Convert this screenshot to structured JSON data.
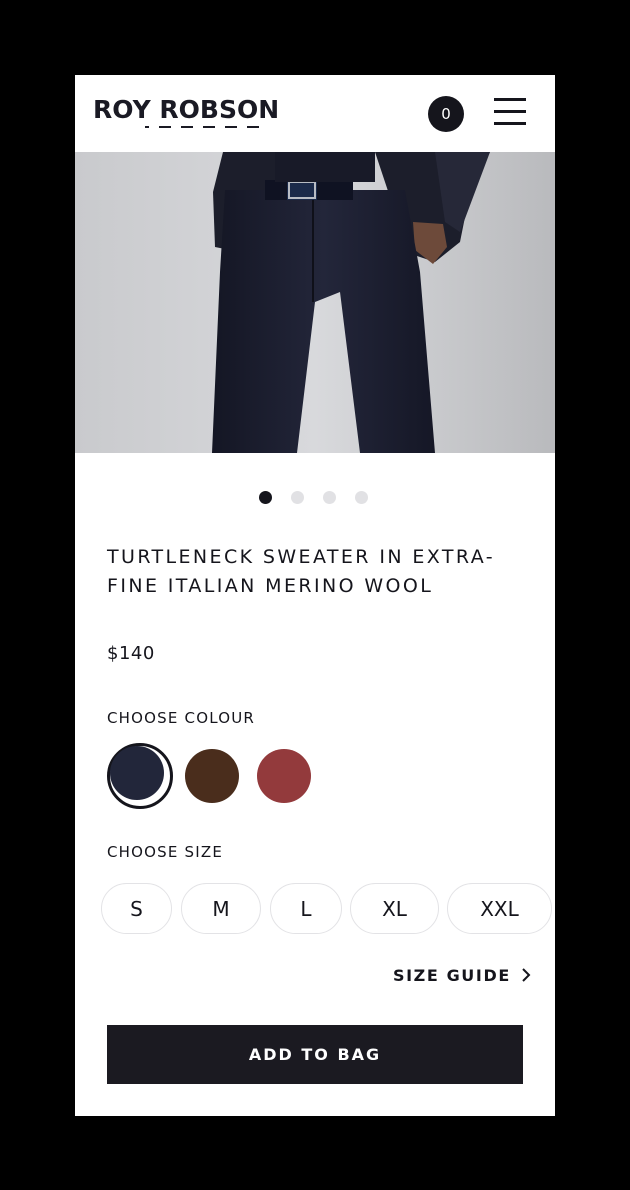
{
  "header": {
    "brand": "ROY ROBSON",
    "cart_count": "0"
  },
  "product": {
    "image_alt": "Model wearing dark navy trousers and jacket with belt",
    "carousel": {
      "total": 4,
      "active_index": 0
    },
    "title": "TURTLENECK SWEATER IN EXTRA-FINE ITALIAN MERINO WOOL",
    "price": "$140"
  },
  "colour": {
    "label": "CHOOSE COLOUR",
    "options": [
      {
        "name": "navy",
        "hex": "#22263a",
        "selected": true
      },
      {
        "name": "brown",
        "hex": "#4a2d1c",
        "selected": false
      },
      {
        "name": "red",
        "hex": "#933a3c",
        "selected": false
      }
    ]
  },
  "size": {
    "label": "CHOOSE SIZE",
    "options": [
      "S",
      "M",
      "L",
      "XL",
      "XXL"
    ],
    "guide_label": "SIZE GUIDE"
  },
  "actions": {
    "add_to_bag": "ADD TO BAG"
  },
  "colors": {
    "text": "#15151c",
    "button_bg": "#1b1a21",
    "border": "#e3e3e6",
    "dot_inactive": "#e1e1e4"
  }
}
